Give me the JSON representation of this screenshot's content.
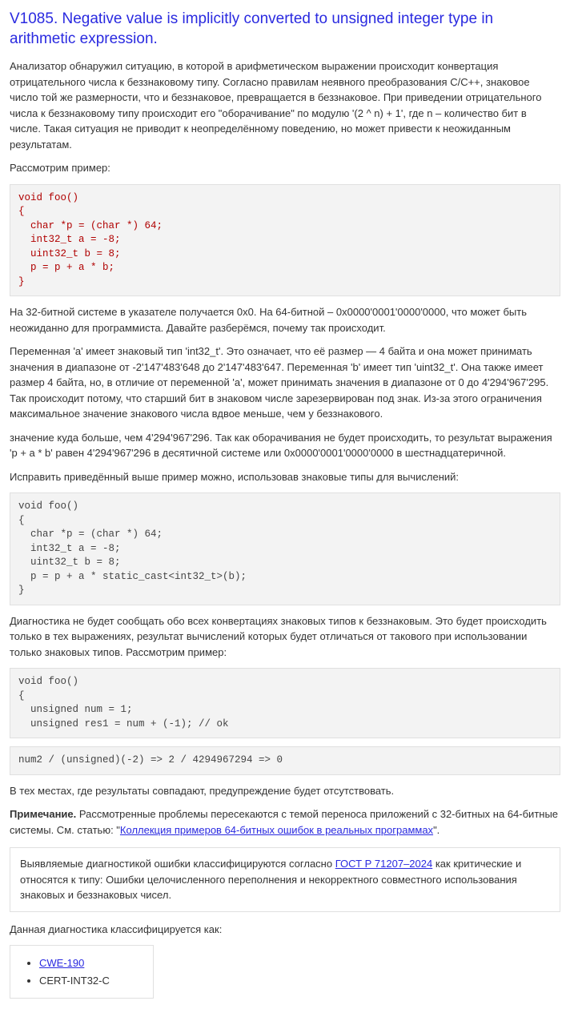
{
  "title": "V1085. Negative value is implicitly converted to unsigned integer type in arithmetic expression.",
  "p1": "Анализатор обнаружил ситуацию, в которой в арифметическом выражении происходит конвертация отрицательного числа к беззнаковому типу. Согласно правилам неявного преобразования C/C++, знаковое число той же размерности, что и беззнаковое, превращается в беззнаковое. При приведении отрицательного числа к беззнаковому типу происходит его \"оборачивание\" по модулю '(2 ^ n) + 1', где n – количество бит в числе. Такая ситуация не приводит к неопределённому поведению, но может привести к неожиданным результатам.",
  "p2": "Рассмотрим пример:",
  "code1": "void foo()\n{\n  char *p = (char *) 64;\n  int32_t a = -8;\n  uint32_t b = 8;\n  p = p + a * b;\n}",
  "p3": "На 32-битной системе в указателе получается 0x0. На 64-битной – 0x0000'0001'0000'0000, что может быть неожиданно для программиста. Давайте разберёмся, почему так происходит.",
  "p4": "Переменная 'a' имеет знаковый тип 'int32_t'. Это означает, что её размер — 4 байта и она может принимать значения в диапазоне от -2'147'483'648 до 2'147'483'647. Переменная 'b' имеет тип 'uint32_t'. Она также имеет размер 4 байта, но, в отличие от переменной 'a', может принимать значения в диапазоне от 0 до 4'294'967'295. Так происходит потому, что старший бит в знаковом числе зарезервирован под знак. Из-за этого ограничения максимальное значение знакового числа вдвое меньше, чем у беззнакового.",
  "p5": "значение куда больше, чем 4'294'967'296. Так как оборачивания не будет происходить, то результат выражения 'p + a * b' равен 4'294'967'296 в десятичной системе или 0x0000'0001'0000'0000 в шестнадцатеричной.",
  "p6": "Исправить приведённый выше пример можно, использовав знаковые типы для вычислений:",
  "code2": "void foo()\n{\n  char *p = (char *) 64;\n  int32_t a = -8;\n  uint32_t b = 8;\n  p = p + a * static_cast<int32_t>(b);\n}",
  "p7": "Диагностика не будет сообщать обо всех конвертациях знаковых типов к беззнаковым. Это будет происходить только в тех выражениях, результат вычислений которых будет отличаться от такового при использовании только знаковых типов. Рассмотрим пример:",
  "code3": "void foo()\n{\n  unsigned num = 1;\n  unsigned res1 = num + (-1); // ok",
  "code4": "num2 / (unsigned)(-2) => 2 / 4294967294 => 0",
  "p8": "В тех местах, где результаты совпадают, предупреждение будет отсутствовать.",
  "note": {
    "label": "Примечание.",
    "text1": " Рассмотренные проблемы пересекаются с темой переноса приложений с 32-битных на 64-битные системы. См. статью: \"",
    "link": "Коллекция примеров 64-битных ошибок в реальных программах",
    "text2": "\"."
  },
  "gost": {
    "pre": "Выявляемые диагностикой ошибки классифицируются согласно ",
    "link": "ГОСТ Р 71207–2024",
    "post": " как критические и относятся к типу: Ошибки целочисленного переполнения и некорректного совместного использования знаковых и беззнаковых чисел."
  },
  "class_intro": "Данная диагностика классифицируется как:",
  "classifications": {
    "cwe": "CWE-190",
    "cert": "CERT-INT32-C"
  }
}
